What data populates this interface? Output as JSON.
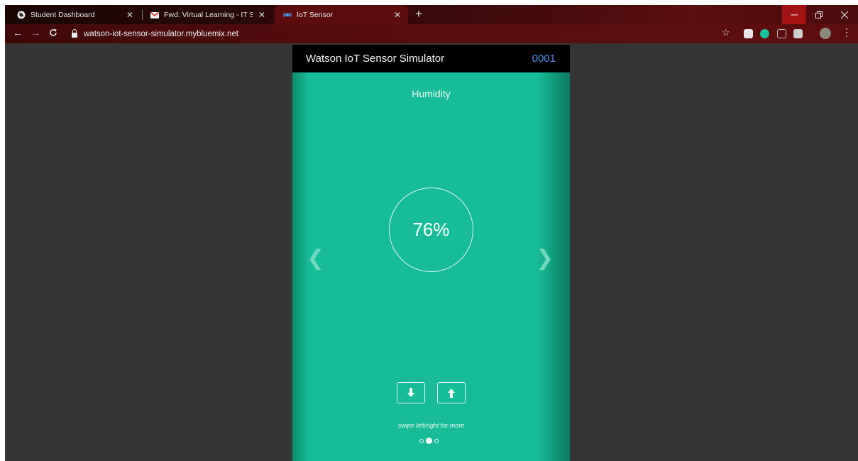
{
  "tabs": [
    {
      "title": "Student Dashboard",
      "icon": "globe-icon",
      "active": false
    },
    {
      "title": "Fwd: Virtual Learning - IT Skill Ce",
      "icon": "gmail-icon",
      "active": false
    },
    {
      "title": "IoT Sensor",
      "icon": "iot-icon",
      "active": true
    }
  ],
  "browser": {
    "url": "watson-iot-sensor-simulator.mybluemix.net"
  },
  "app": {
    "title": "Watson IoT Sensor Simulator",
    "device_id": "0001",
    "sensor_label": "Humidity",
    "sensor_value": "76%",
    "hint": "swipe left/right for more",
    "page_index": 1,
    "page_count": 3
  },
  "colors": {
    "panel_green": "#19bc99",
    "header_black": "#000000",
    "device_id_blue": "#4f8fe0",
    "page_background": "#353535",
    "browser_frame": "#5b0d0d"
  }
}
